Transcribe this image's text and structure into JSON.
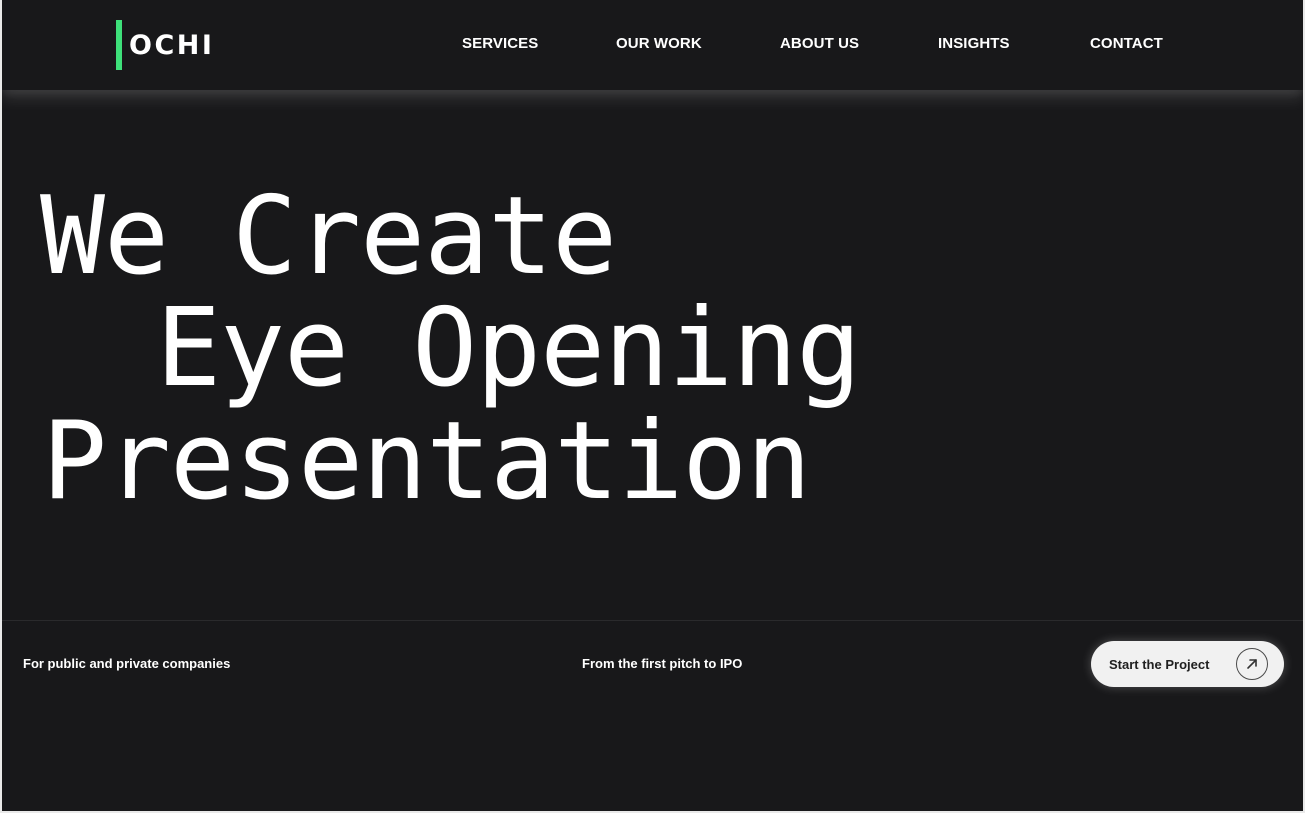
{
  "brand": {
    "name": "OCHI",
    "accent_color": "#3ee07a"
  },
  "nav": {
    "items": [
      {
        "label": "SERVICES"
      },
      {
        "label": "OUR WORK"
      },
      {
        "label": "ABOUT US"
      },
      {
        "label": "INSIGHTS"
      },
      {
        "label": "CONTACT"
      }
    ]
  },
  "hero": {
    "lines": [
      "We Create",
      "Eye Opening",
      "Presentation"
    ]
  },
  "footer": {
    "tagline_left": "For public and private companies",
    "tagline_center": "From the first pitch to IPO",
    "cta": {
      "label": "Start the Project",
      "icon": "arrow-up-right-icon"
    }
  },
  "colors": {
    "background": "#18181a",
    "text": "#ffffff",
    "button_bg": "#f1f1f1"
  }
}
